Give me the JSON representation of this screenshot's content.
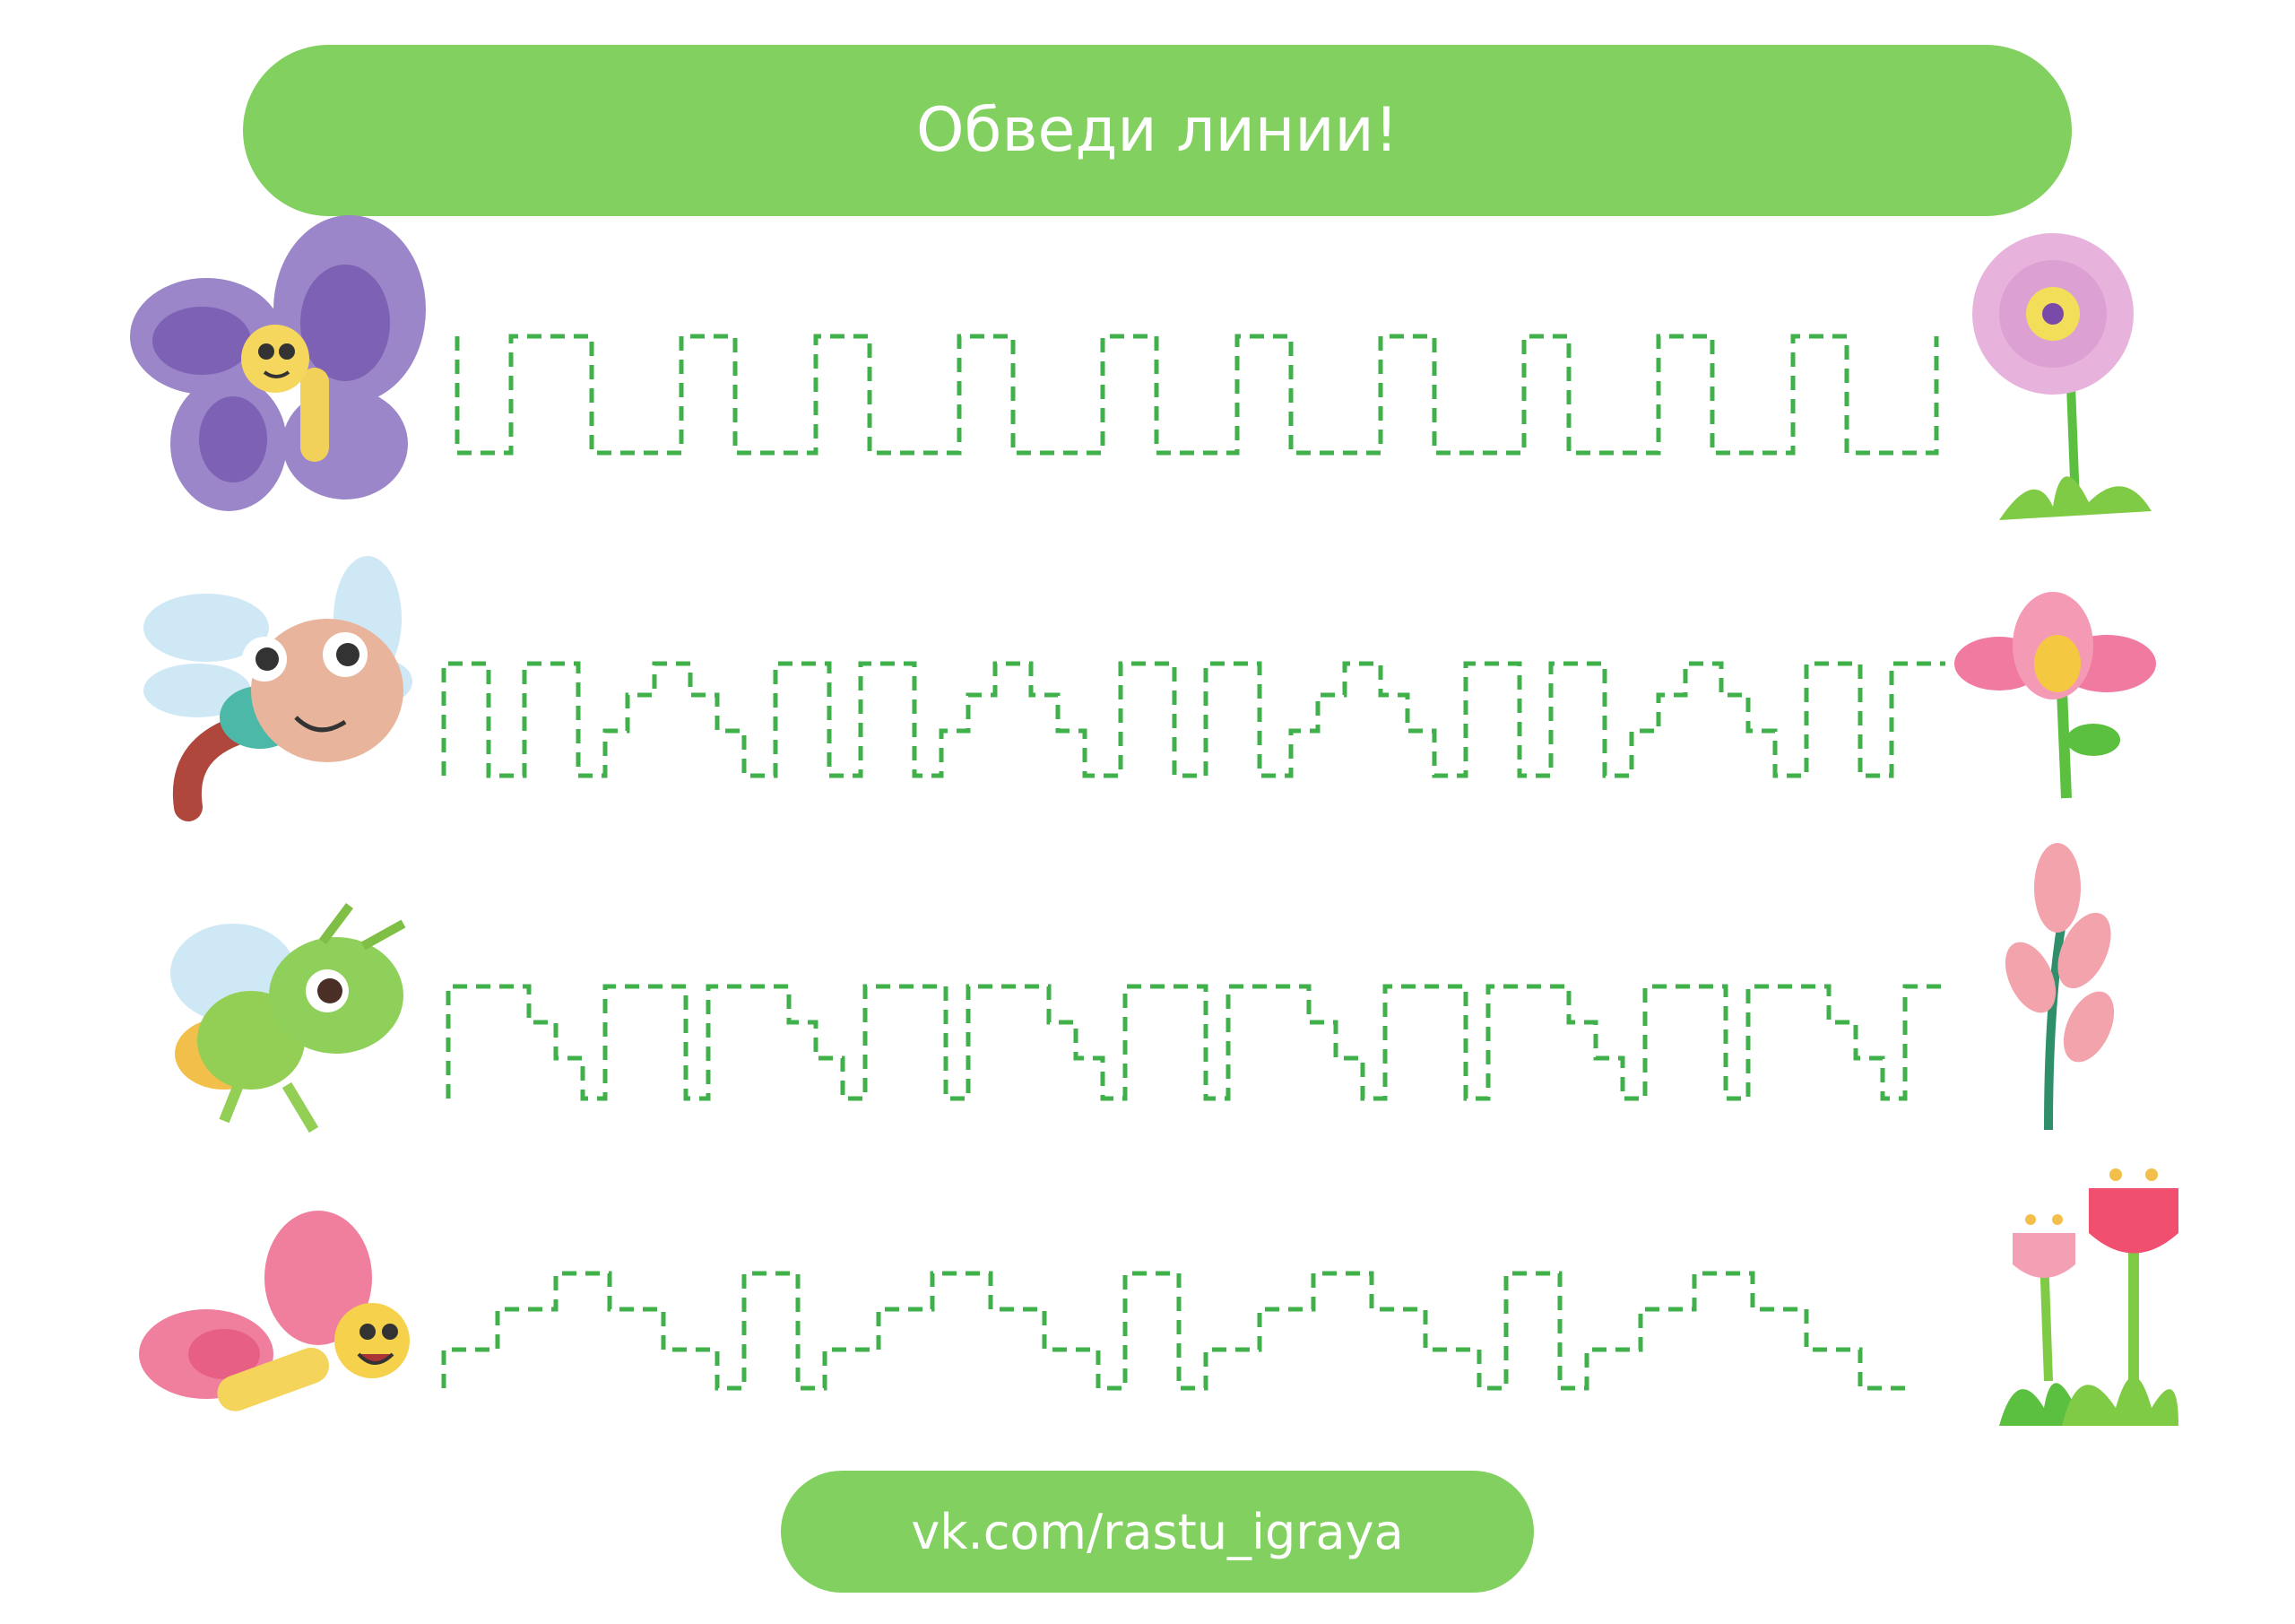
{
  "header": {
    "title": "Обведи линии!"
  },
  "footer": {
    "link": "vk.com/rastu_igraya"
  },
  "colors": {
    "accent": "#82d060",
    "trace_line": "#3fb04a",
    "text": "#ffffff"
  },
  "rows": [
    {
      "start_icon": "purple-butterfly-icon",
      "end_icon": "pink-flower-icon",
      "line": "square-wave"
    },
    {
      "start_icon": "dragonfly-icon",
      "end_icon": "pink-tulip-icon",
      "line": "square-and-stair-wave"
    },
    {
      "start_icon": "grasshopper-icon",
      "end_icon": "flower-branch-icon",
      "line": "stair-down-wave"
    },
    {
      "start_icon": "pink-butterfly-icon",
      "end_icon": "tulips-icon",
      "line": "stair-mountain-wave"
    }
  ]
}
